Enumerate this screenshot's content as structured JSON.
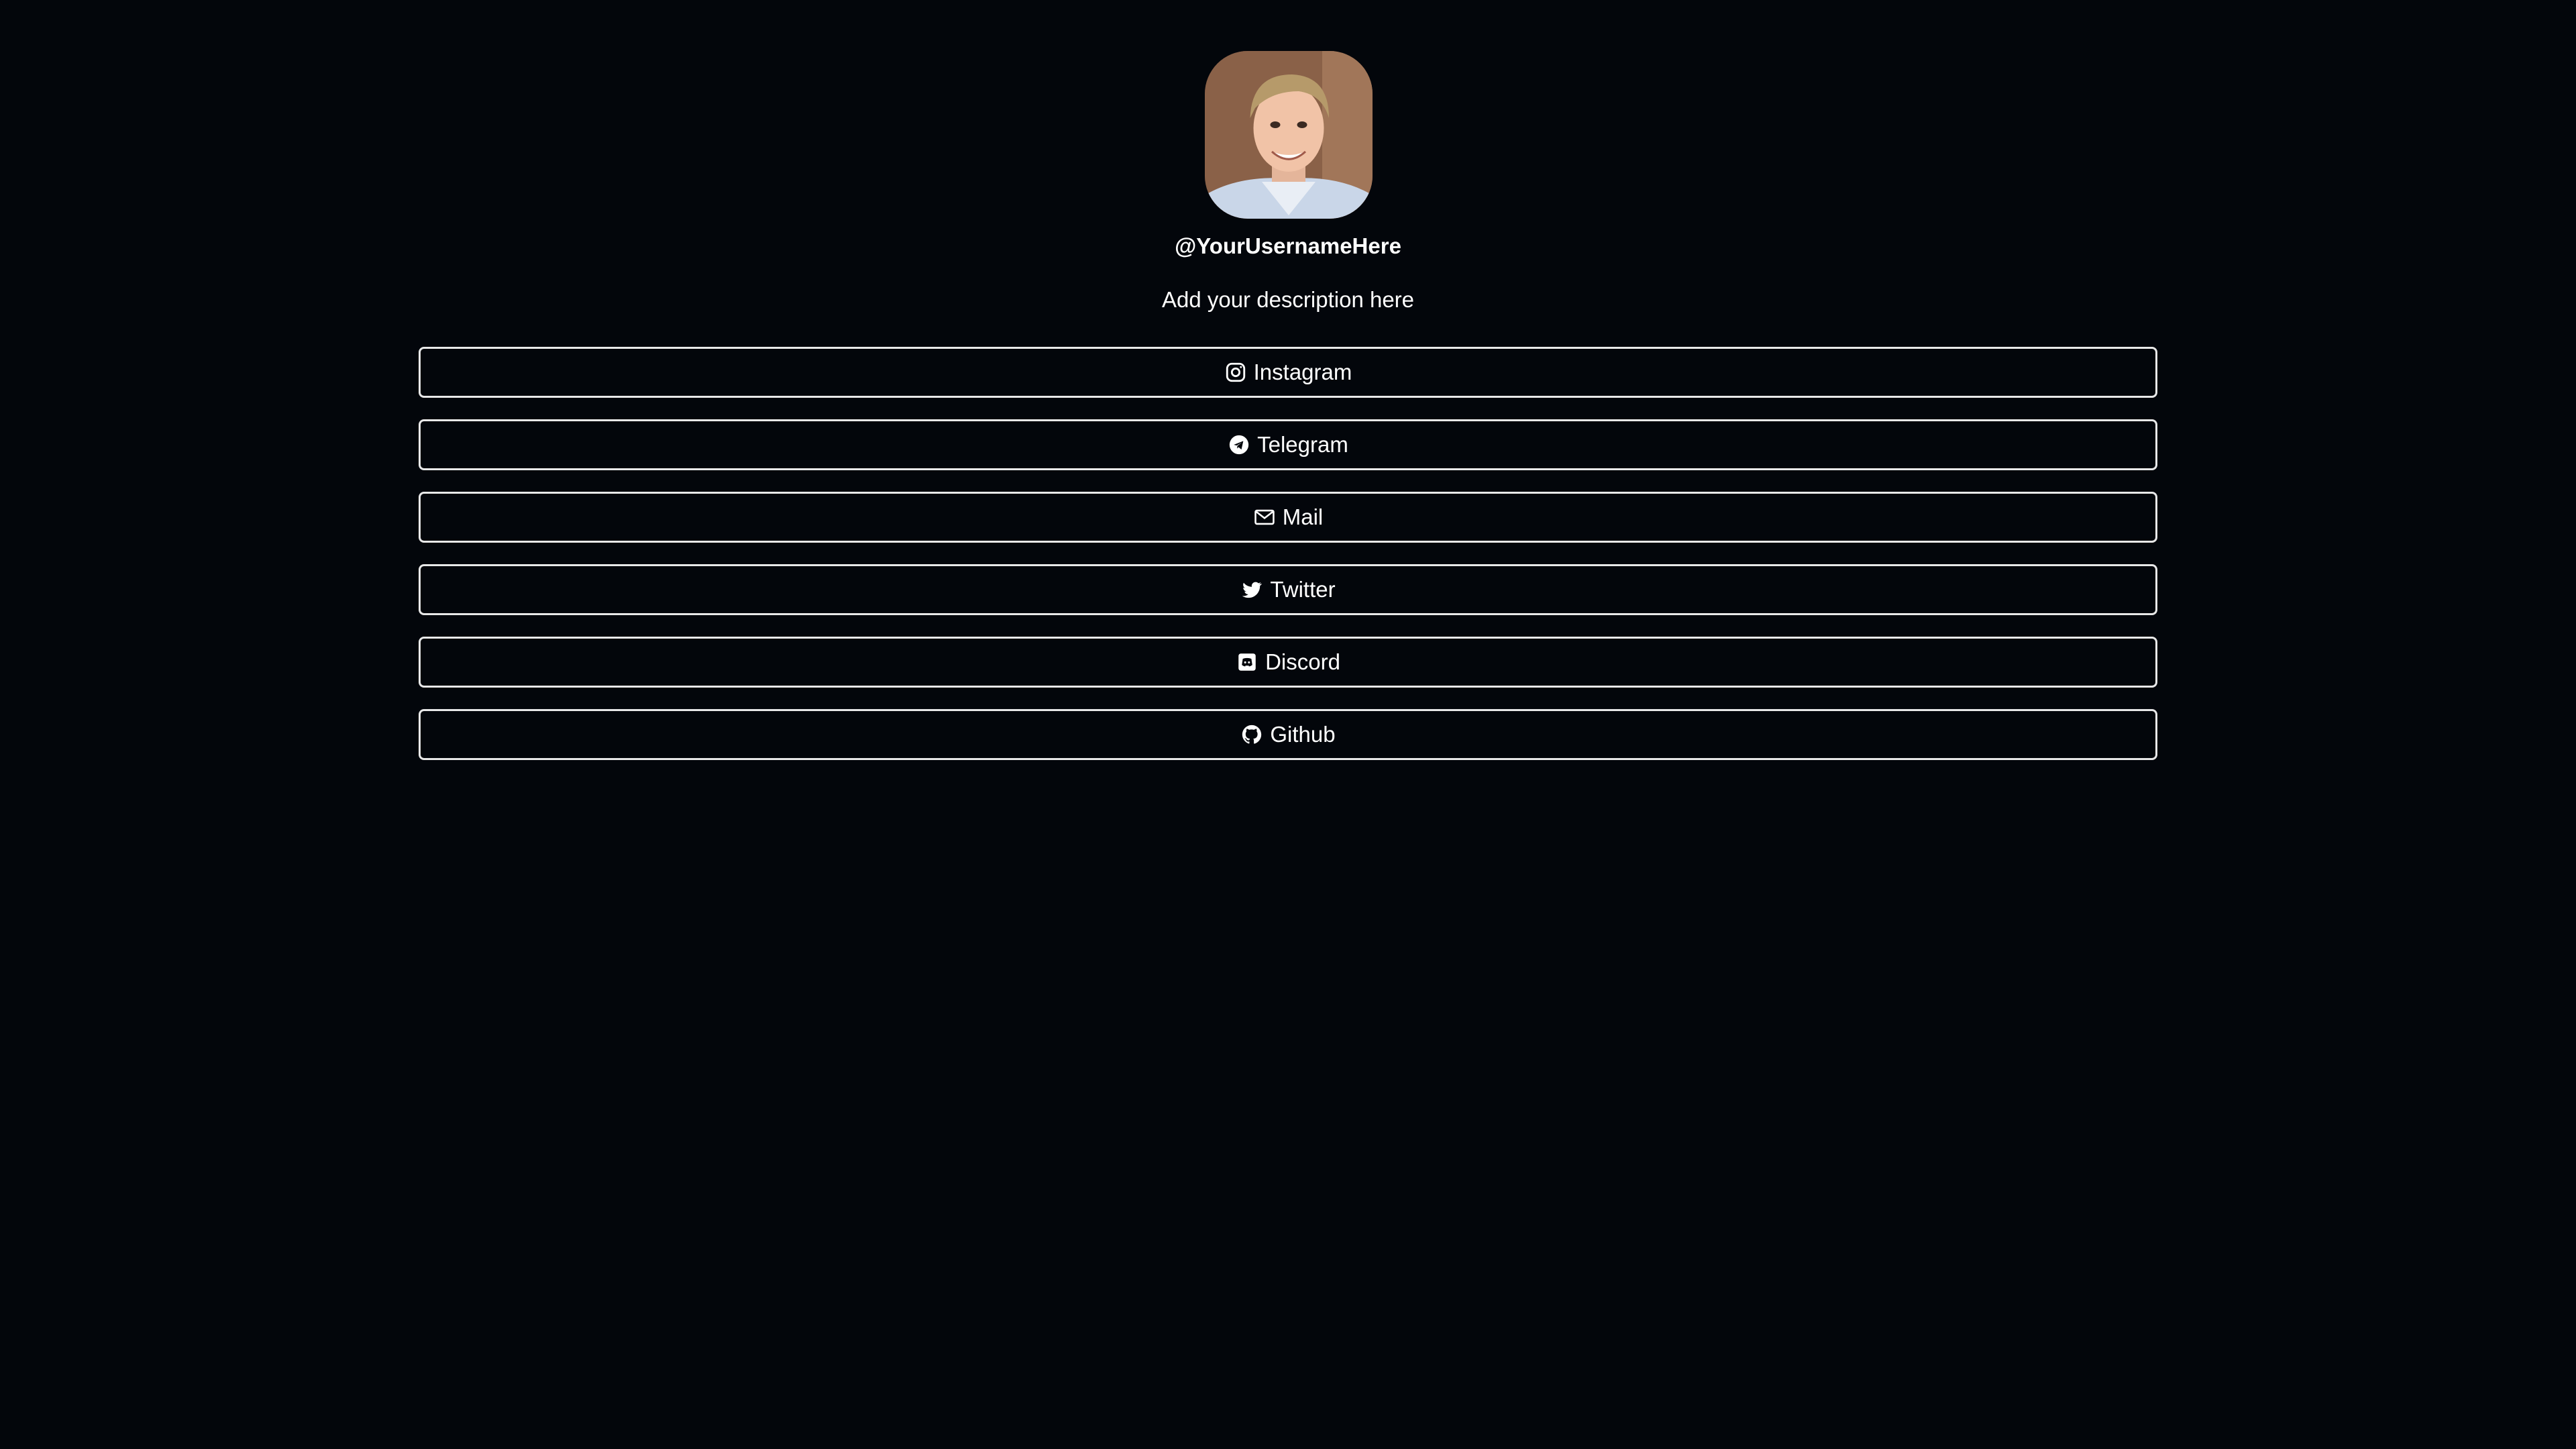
{
  "profile": {
    "username": "@YourUsernameHere",
    "description": "Add your description here"
  },
  "links": [
    {
      "label": "Instagram",
      "icon": "instagram-icon"
    },
    {
      "label": "Telegram",
      "icon": "telegram-icon"
    },
    {
      "label": "Mail",
      "icon": "mail-icon"
    },
    {
      "label": "Twitter",
      "icon": "twitter-icon"
    },
    {
      "label": "Discord",
      "icon": "discord-icon"
    },
    {
      "label": "Github",
      "icon": "github-icon"
    }
  ],
  "colors": {
    "background": "#03060b",
    "text": "#ffffff",
    "button_border": "#e8e8e8"
  }
}
